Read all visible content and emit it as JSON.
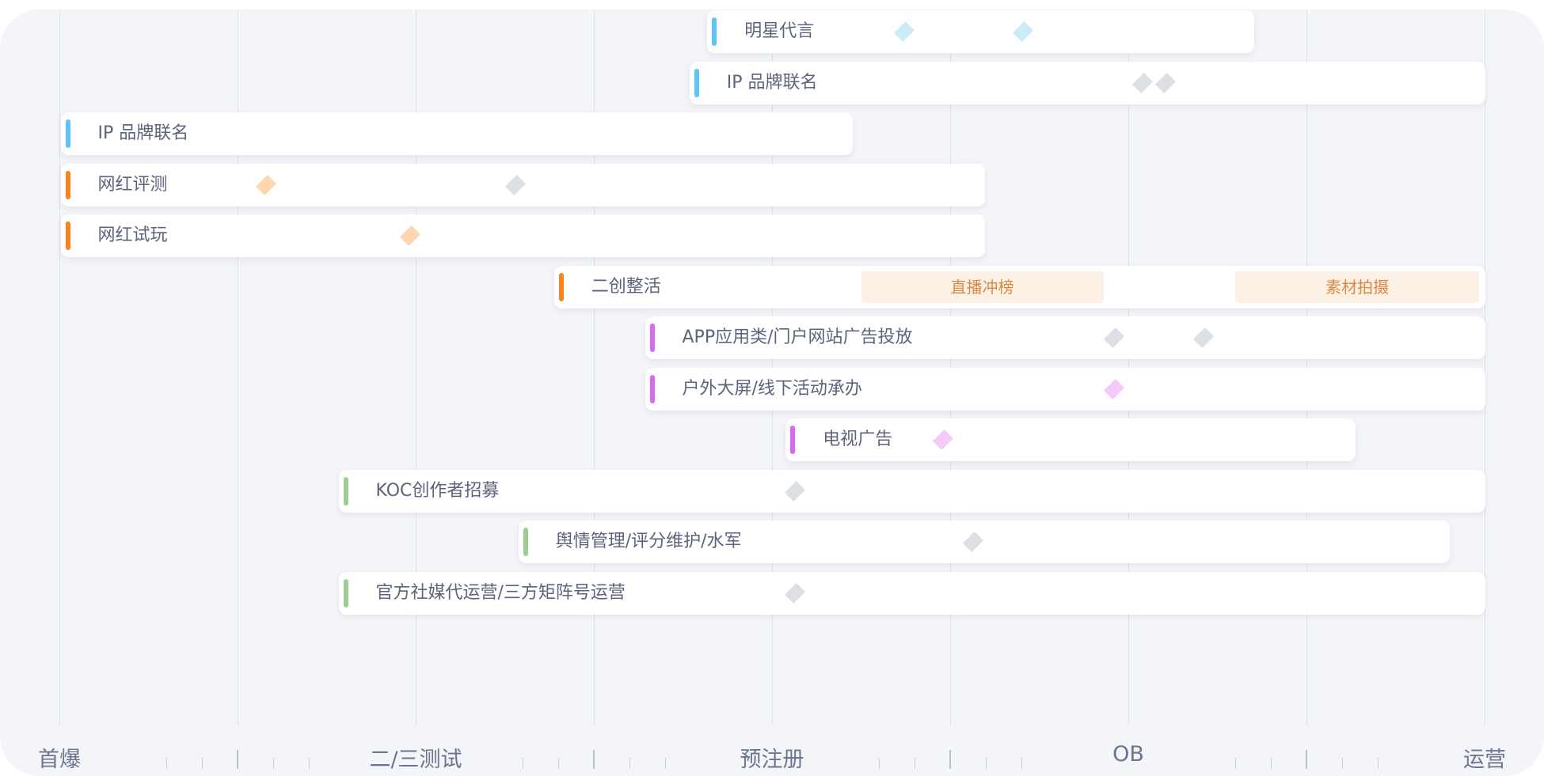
{
  "chart_data": {
    "type": "gantt",
    "title": "",
    "x_axis": {
      "milestones": [
        "首爆",
        "二/三测试",
        "预注册",
        "OB",
        "运营"
      ],
      "range": [
        0,
        8
      ],
      "major_ticks": [
        0,
        1,
        2,
        3,
        4,
        5,
        6,
        7,
        8
      ],
      "minor_ticks_per_interval": 5
    },
    "grid": true,
    "category_colors": {
      "blue": "#60c3f7",
      "orange": "#f6841f",
      "purple": "#d36cf0",
      "green": "#9dcf94"
    },
    "tasks": [
      {
        "label": "明星代言",
        "category": "blue",
        "start": 3.65,
        "end": 6.7,
        "markers": [
          {
            "at": 4.74,
            "color": "#cdeaf8"
          },
          {
            "at": 5.41,
            "color": "#cdeaf8"
          }
        ]
      },
      {
        "label": "IP 品牌联名",
        "category": "blue",
        "start": 3.55,
        "end": 8.0,
        "markers": [
          {
            "at": 6.08,
            "color": "#dcdfe4"
          },
          {
            "at": 6.21,
            "color": "#dcdfe4"
          }
        ]
      },
      {
        "label": "IP 品牌联名",
        "category": "blue",
        "start": 0.02,
        "end": 4.45,
        "markers": []
      },
      {
        "label": "网红评测",
        "category": "orange",
        "start": 0.02,
        "end": 5.19,
        "markers": [
          {
            "at": 1.16,
            "color": "#ffd6b0"
          },
          {
            "at": 2.56,
            "color": "#dcdfe4"
          }
        ]
      },
      {
        "label": "网红试玩",
        "category": "orange",
        "start": 0.02,
        "end": 5.19,
        "markers": [
          {
            "at": 1.97,
            "color": "#ffd6b0"
          }
        ]
      },
      {
        "label": "二创整活",
        "category": "orange",
        "start": 2.79,
        "end": 8.0,
        "markers": [],
        "sub_bars": [
          {
            "label": "直播冲榜",
            "start": 4.5,
            "end": 5.86
          },
          {
            "label": "素材拍摄",
            "start": 6.6,
            "end": 7.97
          }
        ]
      },
      {
        "label": "APP应用类/门户网站广告投放",
        "category": "purple",
        "start": 3.3,
        "end": 8.0,
        "markers": [
          {
            "at": 5.92,
            "color": "#dcdfe4"
          },
          {
            "at": 6.42,
            "color": "#dcdfe4"
          }
        ]
      },
      {
        "label": "户外大屏/线下活动承办",
        "category": "purple",
        "start": 3.3,
        "end": 8.0,
        "markers": [
          {
            "at": 5.92,
            "color": "#f3caf8"
          }
        ]
      },
      {
        "label": "电视广告",
        "category": "purple",
        "start": 4.09,
        "end": 7.27,
        "markers": [
          {
            "at": 4.96,
            "color": "#f3caf8"
          }
        ]
      },
      {
        "label": "KOC创作者招募",
        "category": "green",
        "start": 1.58,
        "end": 8.0,
        "markers": [
          {
            "at": 4.13,
            "color": "#dcdfe4"
          }
        ]
      },
      {
        "label": "舆情管理/评分维护/水军",
        "category": "green",
        "start": 2.59,
        "end": 7.8,
        "markers": [
          {
            "at": 5.13,
            "color": "#dcdfe4"
          }
        ]
      },
      {
        "label": "官方社媒代运营/三方矩阵号运营",
        "category": "green",
        "start": 1.58,
        "end": 8.0,
        "markers": [
          {
            "at": 4.13,
            "color": "#dcdfe4"
          }
        ]
      }
    ]
  }
}
